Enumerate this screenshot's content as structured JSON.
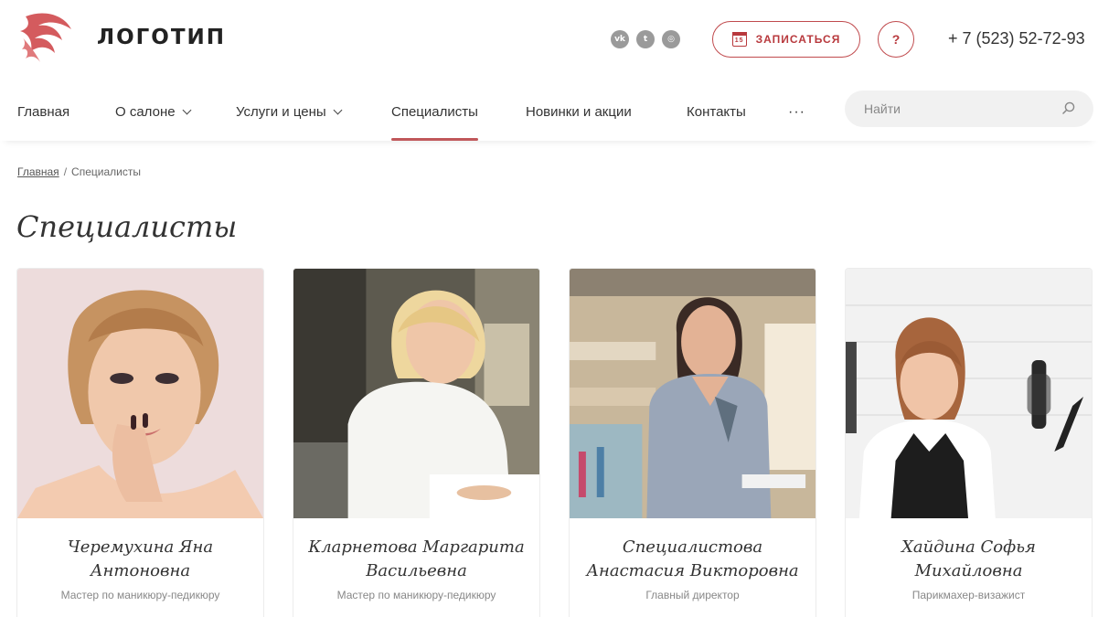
{
  "header": {
    "logo_text": "ЛОГОТИП",
    "socials": [
      {
        "icon": "vk-icon",
        "glyph": "vk"
      },
      {
        "icon": "twitter-icon",
        "glyph": "t"
      },
      {
        "icon": "instagram-icon",
        "glyph": "◎"
      }
    ],
    "book_button_label": "ЗАПИСАТЬСЯ",
    "book_icon_day": "15",
    "help_label": "?",
    "phone": "+ 7 (523) 52-72-93"
  },
  "nav": {
    "items": [
      {
        "label": "Главная",
        "dropdown": false
      },
      {
        "label": "О салоне",
        "dropdown": true
      },
      {
        "label": "Услуги и цены",
        "dropdown": true
      },
      {
        "label": "Специалисты",
        "dropdown": false,
        "active": true
      },
      {
        "label": "Новинки и акции",
        "dropdown": false
      },
      {
        "label": "Контакты",
        "dropdown": false
      }
    ],
    "more_label": "···",
    "search_placeholder": "Найти"
  },
  "breadcrumb": {
    "home": "Главная",
    "separator": "/",
    "current": "Специалисты"
  },
  "page_title": "Специалисты",
  "specialists": [
    {
      "name_line1": "Черемухина Яна",
      "name_line2": "Антоновна",
      "role": "Мастер по маникюру-педикюру"
    },
    {
      "name_line1": "Кларнетова Маргарита",
      "name_line2": "Васильевна",
      "role": "Мастер по маникюру-педикюру"
    },
    {
      "name_line1": "Специалистова",
      "name_line2": "Анастасия Викторовна",
      "role": "Главный директор"
    },
    {
      "name_line1": "Хайдина Софья",
      "name_line2": "Михайловна",
      "role": "Парикмахер-визажист"
    }
  ],
  "colors": {
    "accent": "#b8393d",
    "text": "#333333",
    "muted": "#888888"
  }
}
